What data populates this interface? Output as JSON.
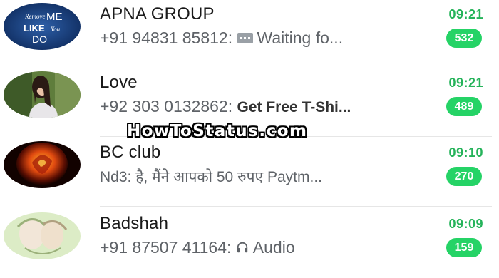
{
  "chats": [
    {
      "name": "APNA GROUP",
      "sender": "+91 94831 85812: ",
      "message": "Waiting fo...",
      "time": "09:21",
      "unread": "532",
      "avatar_icon": "group-avatar-text-logo",
      "avatar_text": [
        "Remove",
        "ME",
        "LIKE",
        "You",
        "DO"
      ]
    },
    {
      "name": "Love",
      "sender": "+92 303 0132862: ",
      "message": "Get Free T-Shi...",
      "time": "09:21",
      "unread": "489",
      "avatar_icon": "girl-photo-avatar"
    },
    {
      "name": "BC club",
      "sender": "Nd3: ",
      "message": "है, मैंने आपको 50 रुपए Paytm...",
      "time": "09:10",
      "unread": "270",
      "avatar_icon": "fire-rose-avatar"
    },
    {
      "name": "Badshah",
      "sender": "+91 87507 41164: ",
      "message": "Audio",
      "time": "09:09",
      "unread": "159",
      "avatar_icon": "couple-sketch-avatar"
    }
  ],
  "watermark": "HowToStatus.com",
  "colors": {
    "accent_green": "#25d366",
    "time_green": "#25b35a",
    "text_primary": "#1a1a1a",
    "text_secondary": "#5f6368"
  }
}
